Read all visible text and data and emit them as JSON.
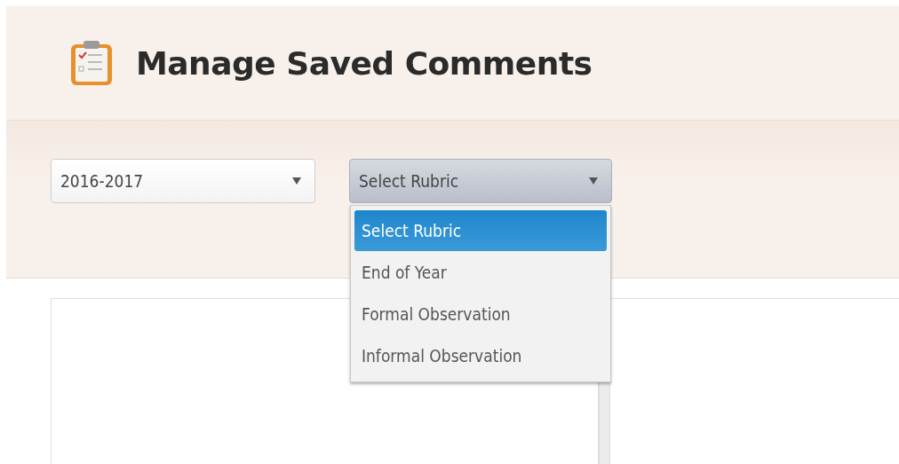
{
  "header": {
    "title": "Manage Saved Comments"
  },
  "filters": {
    "year": {
      "value": "2016-2017"
    },
    "rubric": {
      "value": "Select Rubric",
      "expanded": true,
      "options": [
        {
          "label": "Select Rubric",
          "selected": true
        },
        {
          "label": "End of Year",
          "selected": false
        },
        {
          "label": "Formal Observation",
          "selected": false
        },
        {
          "label": "Informal Observation",
          "selected": false
        }
      ]
    }
  }
}
